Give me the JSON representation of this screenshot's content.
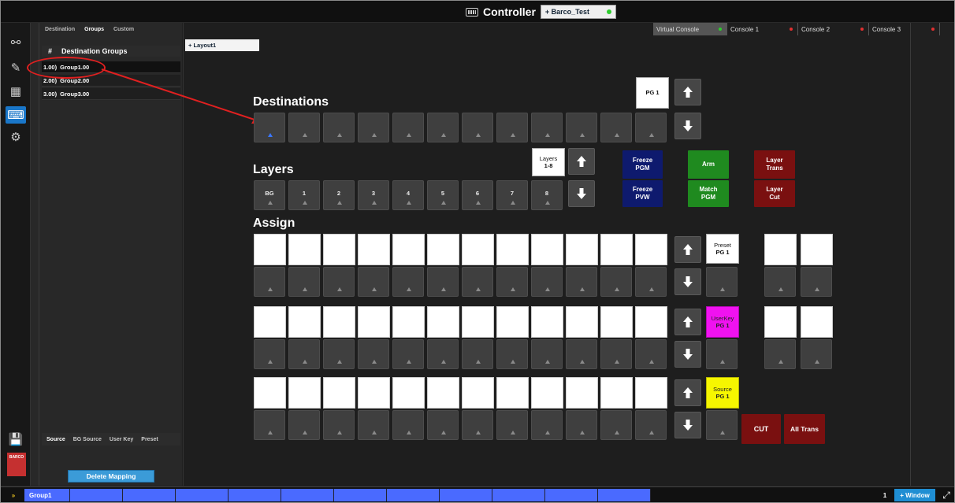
{
  "header": {
    "title": "Controller",
    "preset_name": "+ Barco_Test",
    "consoles": [
      "Virtual Console",
      "Console 1",
      "Console 2",
      "Console 3"
    ]
  },
  "sidebar": {
    "tabs": [
      "Destination",
      "Groups",
      "Custom"
    ],
    "active_tab": "Groups",
    "column_hash": "#",
    "column_title": "Destination Groups",
    "groups": [
      {
        "num": "1.00)",
        "name": "Group1.00"
      },
      {
        "num": "2.00)",
        "name": "Group2.00"
      },
      {
        "num": "3.00)",
        "name": "Group3.00"
      }
    ],
    "bottom_tabs": [
      "Source",
      "BG Source",
      "User Key",
      "Preset"
    ],
    "delete_label": "Delete Mapping",
    "barco_label": "BARCO"
  },
  "layout": {
    "tab_label": "+ Layout1"
  },
  "destinations": {
    "title": "Destinations",
    "pg_label": "PG 1"
  },
  "layers": {
    "title": "Layers",
    "range_line1": "Layers",
    "range_line2": "1-8",
    "buttons": [
      "BG",
      "1",
      "2",
      "3",
      "4",
      "5",
      "6",
      "7",
      "8"
    ]
  },
  "actions": {
    "freeze_pgm": [
      "Freeze",
      "PGM"
    ],
    "freeze_pvw": [
      "Freeze",
      "PVW"
    ],
    "arm": "Arm",
    "match_pgm": [
      "Match",
      "PGM"
    ],
    "layer_trans": [
      "Layer",
      "Trans"
    ],
    "layer_cut": [
      "Layer",
      "Cut"
    ],
    "cut": "CUT",
    "all_trans": "All Trans"
  },
  "assign": {
    "title": "Assign",
    "preset": [
      "Preset",
      "PG 1"
    ],
    "userkey": [
      "UserKey",
      "PG 1"
    ],
    "source": [
      "Source",
      "PG 1"
    ]
  },
  "bottombar": {
    "group_label": "Group1",
    "page_number": "1",
    "window_label": "+ Window"
  },
  "colors": {
    "accent_blue": "#1a77c9",
    "freeze_blue": "#0e1a6e",
    "arm_green": "#1f8a1f",
    "layer_red": "#7a1010",
    "userkey_magenta": "#f012f0",
    "source_yellow": "#f6f600"
  }
}
